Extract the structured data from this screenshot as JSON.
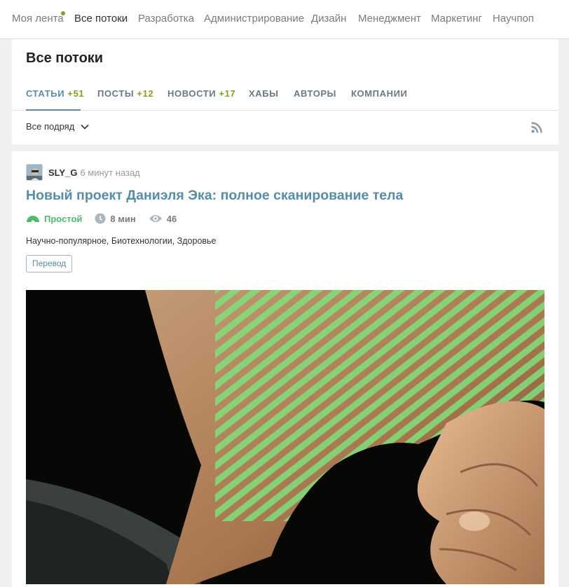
{
  "topnav": {
    "items": [
      {
        "label": "Моя лента"
      },
      {
        "label": "Все потоки"
      },
      {
        "label": "Разработка"
      },
      {
        "label": "Администрирование"
      },
      {
        "label": "Дизайн"
      },
      {
        "label": "Менеджмент"
      },
      {
        "label": "Маркетинг"
      },
      {
        "label": "Научпоп"
      }
    ]
  },
  "page": {
    "title": "Все потоки",
    "tabs": [
      {
        "label": "СТАТЬИ",
        "count": "+51"
      },
      {
        "label": "ПОСТЫ",
        "count": "+12"
      },
      {
        "label": "НОВОСТИ",
        "count": "+17"
      },
      {
        "label": "ХАБЫ"
      },
      {
        "label": "АВТОРЫ"
      },
      {
        "label": "КОМПАНИИ"
      }
    ],
    "filter_label": "Все подряд"
  },
  "article": {
    "author": "SLY_G",
    "time": "6 минут назад",
    "title": "Новый проект Даниэля Эка: полное сканирование тела",
    "level": "Простой",
    "reading_time": "8 мин",
    "views": "46",
    "hubs": [
      "Научно-популярное,",
      "Биотехнологии,",
      "Здоровье"
    ],
    "badge": "Перевод"
  },
  "colors": {
    "accent": "#548eaa",
    "counter": "#7fa21f",
    "level": "#4cbc6c"
  },
  "icons": [
    "chevron-down-icon",
    "rss-icon",
    "level-icon",
    "clock-icon",
    "eye-icon",
    "avatar"
  ]
}
